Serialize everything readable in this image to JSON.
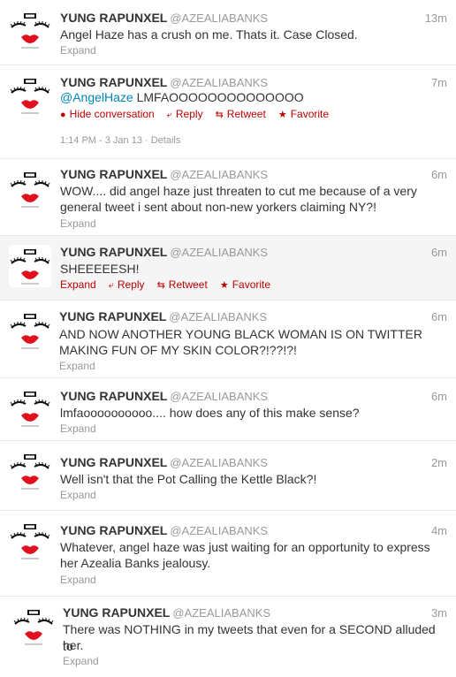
{
  "colors": {
    "action_red": "#bb0000",
    "mention_blue": "#0084b4",
    "muted": "#999999",
    "hover_bg": "#f5f5f5"
  },
  "tweets": [
    {
      "name": "YUNG RAPUNXEL",
      "handle": "@AZEALIABANKS",
      "time": "13m",
      "lines": [
        "Angel Haze has a crush on me. Thats it. Case Closed."
      ],
      "expand": "Expand"
    },
    {
      "name": "YUNG RAPUNXEL",
      "handle": "@AZEALIABANKS",
      "time": "7m",
      "mention": "@AngelHaze",
      "text": " LMFAOOOOOOOOOOOOOO",
      "actions": {
        "hide": "Hide conversation",
        "reply": "Reply",
        "retweet": "Retweet",
        "favorite": "Favorite"
      },
      "meta": "1:14 PM - 3 Jan 13 · Details"
    },
    {
      "name": "YUNG RAPUNXEL",
      "handle": "@AZEALIABANKS",
      "time": "6m",
      "lines": [
        "WOW.... did angel haze just threaten to cut me because of a very",
        "general tweet i sent about non-new yorkers claiming NY?!"
      ],
      "expand": "Expand"
    },
    {
      "name": "YUNG RAPUNXEL",
      "handle": "@AZEALIABANKS",
      "time": "6m",
      "lines": [
        "SHEEEEESH!"
      ],
      "actions": {
        "expand": "Expand",
        "reply": "Reply",
        "retweet": "Retweet",
        "favorite": "Favorite"
      }
    },
    {
      "name": "YUNG RAPUNXEL",
      "handle": "@AZEALIABANKS",
      "time": "6m",
      "lines": [
        "AND NOW ANOTHER YOUNG BLACK WOMAN IS ON TWITTER",
        "MAKING FUN OF MY SKIN COLOR?!??!?!"
      ],
      "expand": "Expand"
    },
    {
      "name": "YUNG RAPUNXEL",
      "handle": "@AZEALIABANKS",
      "time": "6m",
      "lines": [
        "lmfaoooooooooo.... how does any of this make sense?"
      ],
      "expand": "Expand"
    },
    {
      "name": "YUNG RAPUNXEL",
      "handle": "@AZEALIABANKS",
      "time": "2m",
      "lines": [
        "Well isn't that the Pot Calling the Kettle Black?!"
      ],
      "expand": "Expand"
    },
    {
      "name": "YUNG RAPUNXEL",
      "handle": "@AZEALIABANKS",
      "time": "4m",
      "lines": [
        "Whatever, angel haze was just waiting for an opportunity to express",
        "her Azealia Banks jealousy."
      ],
      "expand": "Expand"
    },
    {
      "name": "YUNG RAPUNXEL",
      "handle": "@AZEALIABANKS",
      "time": "3m",
      "lines": [
        "There was NOTHING in my tweets that even for a SECOND alluded to",
        "her."
      ],
      "expand": "Expand"
    }
  ]
}
